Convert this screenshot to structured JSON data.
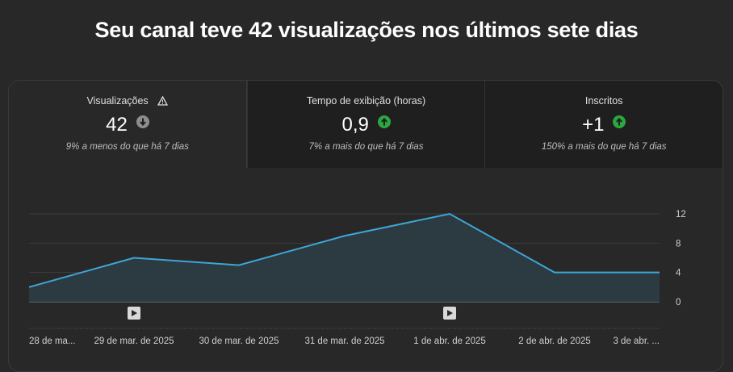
{
  "headline": "Seu canal teve 42 visualizações nos últimos sete dias",
  "metrics": [
    {
      "label": "Visualizações",
      "value": "42",
      "note": "9% a menos do que há 7 dias",
      "trend": "down",
      "color": "#8e8e8e"
    },
    {
      "label": "Tempo de exibição (horas)",
      "value": "0,9",
      "note": "7% a mais do que há 7 dias",
      "trend": "up",
      "color": "#2ba640"
    },
    {
      "label": "Inscritos",
      "value": "+1",
      "note": "150% a mais do que há 7 dias",
      "trend": "up",
      "color": "#2ba640"
    }
  ],
  "chart_data": {
    "type": "area",
    "x": [
      "28 de ma...",
      "29 de mar. de 2025",
      "30 de mar. de 2025",
      "31 de mar. de 2025",
      "1 de abr. de 2025",
      "2 de abr. de 2025",
      "3 de abr. ..."
    ],
    "series": [
      {
        "values": [
          2,
          6,
          5,
          9,
          12,
          4,
          4
        ]
      }
    ],
    "yticks": [
      "0",
      "4",
      "8",
      "12"
    ],
    "ylim": [
      0,
      12
    ],
    "grid": true,
    "line_color": "#3ea6d6",
    "fill_color": "#2c3c44",
    "video_markers": [
      1,
      4
    ]
  }
}
